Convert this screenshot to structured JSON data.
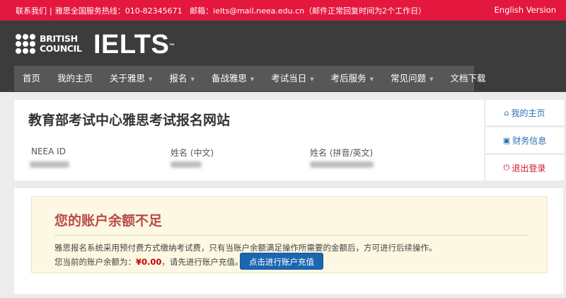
{
  "topbar": {
    "contact": "联系我们",
    "hotline": "雅思全国服务热线：010-82345671",
    "email": "邮箱：ielts@mail.neea.edu.cn（邮件正常回复时间为2个工作日）",
    "english_version": "English Version"
  },
  "logo": {
    "british_council_line1": "BRITISH",
    "british_council_line2": "COUNCIL",
    "ielts": "IELTS",
    "tm": "™"
  },
  "nav": {
    "items": [
      {
        "label": "首页",
        "dropdown": false
      },
      {
        "label": "我的主页",
        "dropdown": false
      },
      {
        "label": "关于雅思",
        "dropdown": true
      },
      {
        "label": "报名",
        "dropdown": true
      },
      {
        "label": "备战雅思",
        "dropdown": true
      },
      {
        "label": "考试当日",
        "dropdown": true
      },
      {
        "label": "考后服务",
        "dropdown": true
      },
      {
        "label": "常见问题",
        "dropdown": true
      },
      {
        "label": "文档下载",
        "dropdown": false
      }
    ],
    "caret": "▼"
  },
  "profile": {
    "site_title": "教育部考试中心雅思考试报名网站",
    "fields": [
      {
        "label": "NEEA ID"
      },
      {
        "label": "姓名 (中文)"
      },
      {
        "label": "姓名 (拼音/英文)"
      }
    ]
  },
  "sidebar": {
    "items": [
      {
        "label": "我的主页",
        "icon": "home-icon",
        "glyph": "⌂"
      },
      {
        "label": "财务信息",
        "icon": "briefcase-icon",
        "glyph": "▣"
      },
      {
        "label": "退出登录",
        "icon": "power-icon",
        "glyph": "⏻"
      }
    ]
  },
  "alert": {
    "title": "您的账户余额不足",
    "line1": "雅思报名系统采用预付费方式缴纳考试费，只有当账户余额满足操作所需要的金额后，方可进行后续操作。",
    "balance_prefix": "您当前的账户余额为：",
    "balance_amount": "¥0.00",
    "balance_suffix": "，请先进行账户充值。",
    "button_label": "点击进行账户充值"
  },
  "colors": {
    "topbar": "#e4173f",
    "header": "#3c3c3c",
    "nav": "#575757",
    "link": "#2a6fb4",
    "danger": "#d11a28",
    "primary_button": "#1a66b0"
  }
}
